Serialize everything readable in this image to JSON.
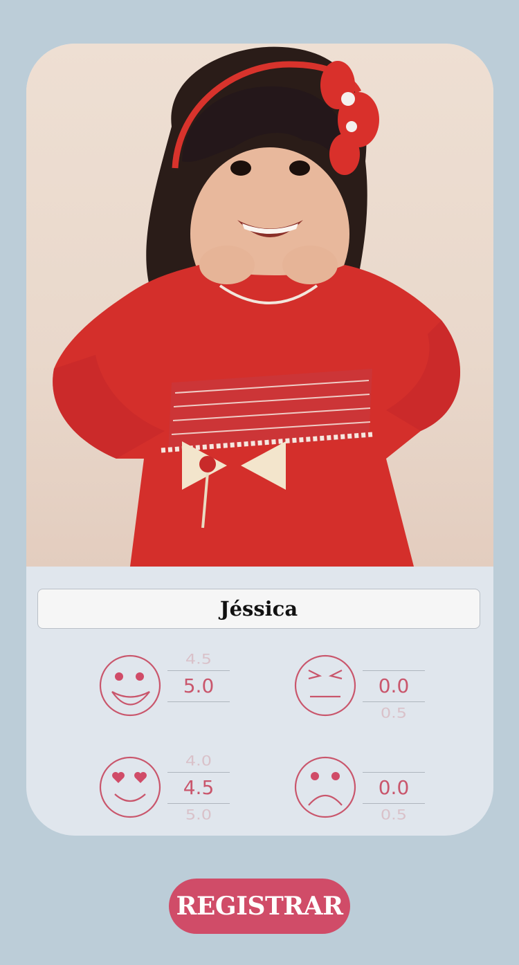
{
  "profile": {
    "photo_icon": "child-photo",
    "name": "Jéssica"
  },
  "ratings": [
    {
      "face": "big-smile-face-icon",
      "prev": "4.5",
      "value": "5.0",
      "next": ""
    },
    {
      "face": "angry-face-icon",
      "prev": "",
      "value": "0.0",
      "next": "0.5"
    },
    {
      "face": "heart-eyes-face-icon",
      "prev": "4.0",
      "value": "4.5",
      "next": "5.0"
    },
    {
      "face": "sad-face-icon",
      "prev": "",
      "value": "0.0",
      "next": "0.5"
    }
  ],
  "actions": {
    "register_label": "REGISTRAR"
  },
  "colors": {
    "background": "#bccdd8",
    "card": "#e0e6ed",
    "accent": "#d04c68",
    "face_stroke": "#c9566c"
  }
}
